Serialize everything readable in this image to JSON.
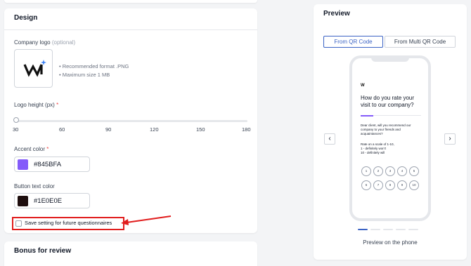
{
  "design": {
    "title": "Design",
    "company_logo_label": "Company logo",
    "company_logo_optional": "(optional)",
    "logo_text": "W",
    "hint_format": "• Recommended format .PNG",
    "hint_size": "• Maximum size 1 MB",
    "logo_height_label": "Logo height (px)",
    "required_mark": "*",
    "slider_ticks": [
      "30",
      "60",
      "90",
      "120",
      "150",
      "180"
    ],
    "slider_value": 30,
    "accent_label": "Accent color",
    "accent_value": "#845BFA",
    "button_text_label": "Button text color",
    "button_text_value": "#1E0E0E",
    "save_label": "Save setting for future questionnaires"
  },
  "bonus": {
    "title": "Bonus for review"
  },
  "preview": {
    "title": "Preview",
    "tab_qr": "From QR Code",
    "tab_multi": "From Multi QR Code",
    "prev_icon": "‹",
    "next_icon": "›",
    "phone": {
      "logo": "W",
      "question": "How do you rate your visit to our company?",
      "body": "Dear client, will you recommend our company to your friends and acquaintances?",
      "scale_1": "Rate on a scale of 1-10,",
      "scale_2": "1 - definitely won't",
      "scale_3": "10 - definitely will",
      "ratings_row1": [
        "1",
        "2",
        "3",
        "4",
        "5"
      ],
      "ratings_row2": [
        "6",
        "7",
        "8",
        "9",
        "10"
      ]
    },
    "caption": "Preview on the phone"
  },
  "colors": {
    "accent": "#845BFA",
    "button_text": "#1E0E0E",
    "highlight": "#e11d1d",
    "tab_active": "#3b63c4"
  }
}
